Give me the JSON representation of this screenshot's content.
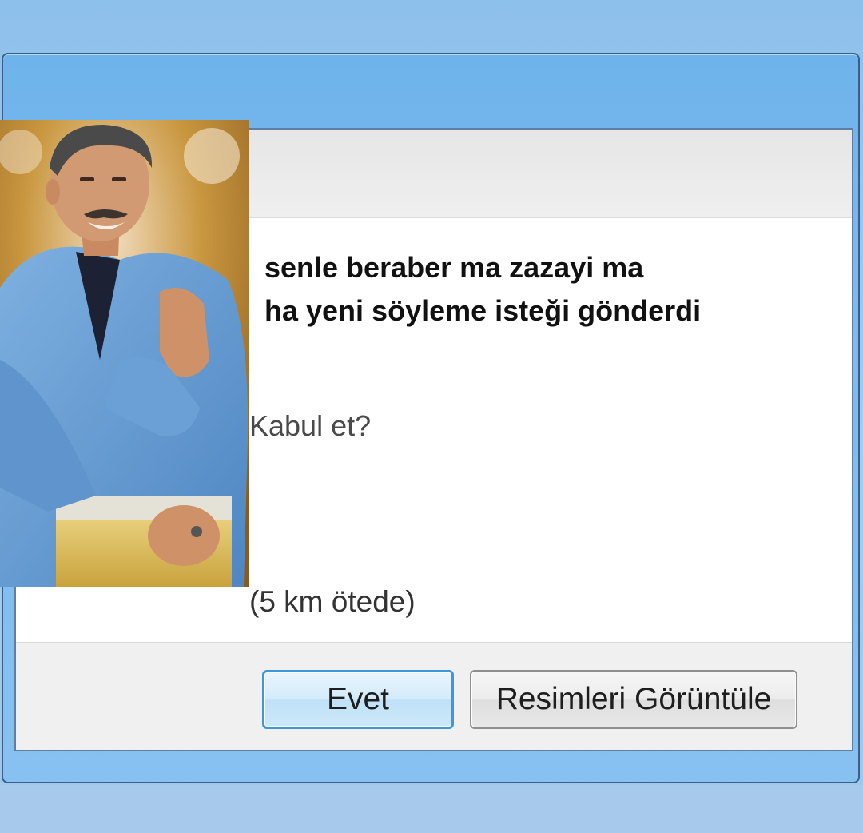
{
  "dialog": {
    "message_lines": [
      "senle beraber ma zazayi ma",
      "ha yeni söyleme isteği gönderdi"
    ],
    "question": "Kabul et?",
    "distance": "(5 km ötede)",
    "buttons": {
      "yes_label": "Evet",
      "view_images_label": "Resimleri Görüntüle"
    }
  },
  "colors": {
    "desktop": "#8ec0ec",
    "window_frame": "#7dbcf0",
    "client_bg": "#ffffff",
    "default_button_border": "#3c98d8"
  },
  "icons": {
    "avatar": "profile-photo"
  }
}
